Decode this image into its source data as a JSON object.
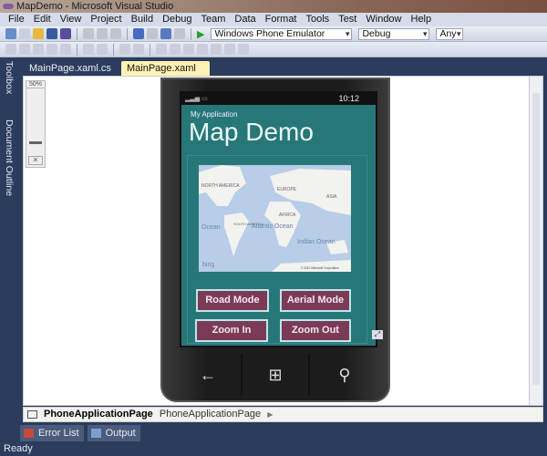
{
  "window": {
    "title": "MapDemo - Microsoft Visual Studio"
  },
  "menu": [
    "File",
    "Edit",
    "View",
    "Project",
    "Build",
    "Debug",
    "Team",
    "Data",
    "Format",
    "Tools",
    "Test",
    "Window",
    "Help"
  ],
  "toolbar": {
    "target": "Windows Phone Emulator",
    "config": "Debug",
    "platform": "Any"
  },
  "tabs": [
    {
      "label": "MainPage.xaml.cs"
    },
    {
      "label": "MainPage.xaml",
      "close": "✕"
    }
  ],
  "side": {
    "toolbox": "Toolbox",
    "outline": "Document Outline"
  },
  "zoom": {
    "level": "50%"
  },
  "phone": {
    "time": "10:12",
    "app_name": "My Application",
    "page_title": "Map Demo",
    "map_labels": {
      "na": "NORTH AMERICA",
      "eu": "EUROPE",
      "asia": "ASIA",
      "africa": "AFRICA",
      "sa": "SOUTH AMERICA",
      "ocean": "Ocean",
      "atlantic": "Atlantic Ocean",
      "indian": "Indian Ocean",
      "bing": "bing",
      "copyright": "© 2010 Microsoft Corporation"
    },
    "buttons": {
      "road": "Road Mode",
      "aerial": "Aerial Mode",
      "zoom_in": "Zoom In",
      "zoom_out": "Zoom Out"
    }
  },
  "breadcrumb": {
    "bold": "PhoneApplicationPage",
    "normal": "PhoneApplicationPage"
  },
  "bottom_tabs": {
    "errors": "Error List",
    "output": "Output"
  },
  "status": "Ready",
  "colors": {
    "accent": "#277778",
    "button": "#7b3b56"
  }
}
